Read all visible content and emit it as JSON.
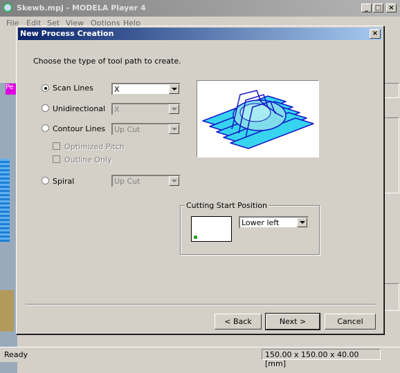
{
  "window": {
    "title": "Skewb.mpj - MODELA Player 4",
    "min": "_",
    "max": "□",
    "close": "×"
  },
  "menu": [
    "File",
    "Edit",
    "Set",
    "View",
    "Options",
    "Help"
  ],
  "background": {
    "tab_label": "Pe"
  },
  "status": {
    "left": "Ready",
    "dimensions": "150.00 x 150.00 x 40.00 [mm]"
  },
  "dialog": {
    "title": "New Process Creation",
    "close": "×",
    "instruction": "Choose the type of tool path to create.",
    "options": [
      {
        "label": "Scan Lines",
        "selected": true,
        "combo": "X",
        "enabled": true
      },
      {
        "label": "Unidirectional",
        "selected": false,
        "combo": "X",
        "enabled": false
      },
      {
        "label": "Contour Lines",
        "selected": false,
        "combo": "Up Cut",
        "enabled": false
      },
      {
        "label": "Spiral",
        "selected": false,
        "combo": "Up Cut",
        "enabled": false
      }
    ],
    "checkboxes": [
      {
        "label": "Optimized Pitch",
        "checked": false,
        "enabled": false
      },
      {
        "label": "Outline Only",
        "checked": false,
        "enabled": false
      }
    ],
    "cutting_start": {
      "label": "Cutting Start Position",
      "value": "Lower left"
    },
    "buttons": {
      "back": "< Back",
      "next": "Next >",
      "cancel": "Cancel"
    }
  }
}
